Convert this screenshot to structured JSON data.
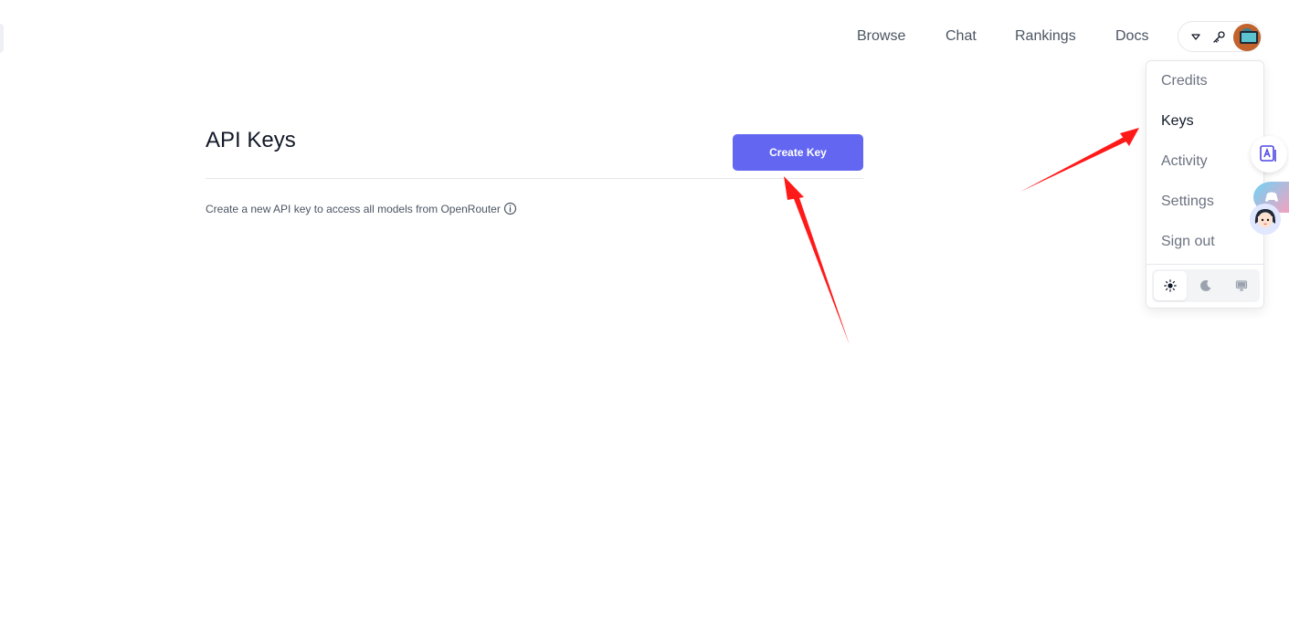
{
  "nav": {
    "links": [
      "Browse",
      "Chat",
      "Rankings",
      "Docs"
    ]
  },
  "user_menu": {
    "items": [
      "Credits",
      "Keys",
      "Activity",
      "Settings",
      "Sign out"
    ],
    "active_item": "Keys",
    "theme_options": [
      "light",
      "dark",
      "system"
    ],
    "selected_theme": "light"
  },
  "main": {
    "title": "API Keys",
    "create_button": "Create Key",
    "description": "Create a new API key to access all models from OpenRouter"
  },
  "colors": {
    "accent": "#6366f1",
    "annotation_arrow": "#ff1a1a"
  },
  "icons": [
    "chevron-down-icon",
    "key-icon",
    "avatar",
    "sun-icon",
    "moon-icon",
    "monitor-icon",
    "info-icon",
    "translate-icon"
  ]
}
